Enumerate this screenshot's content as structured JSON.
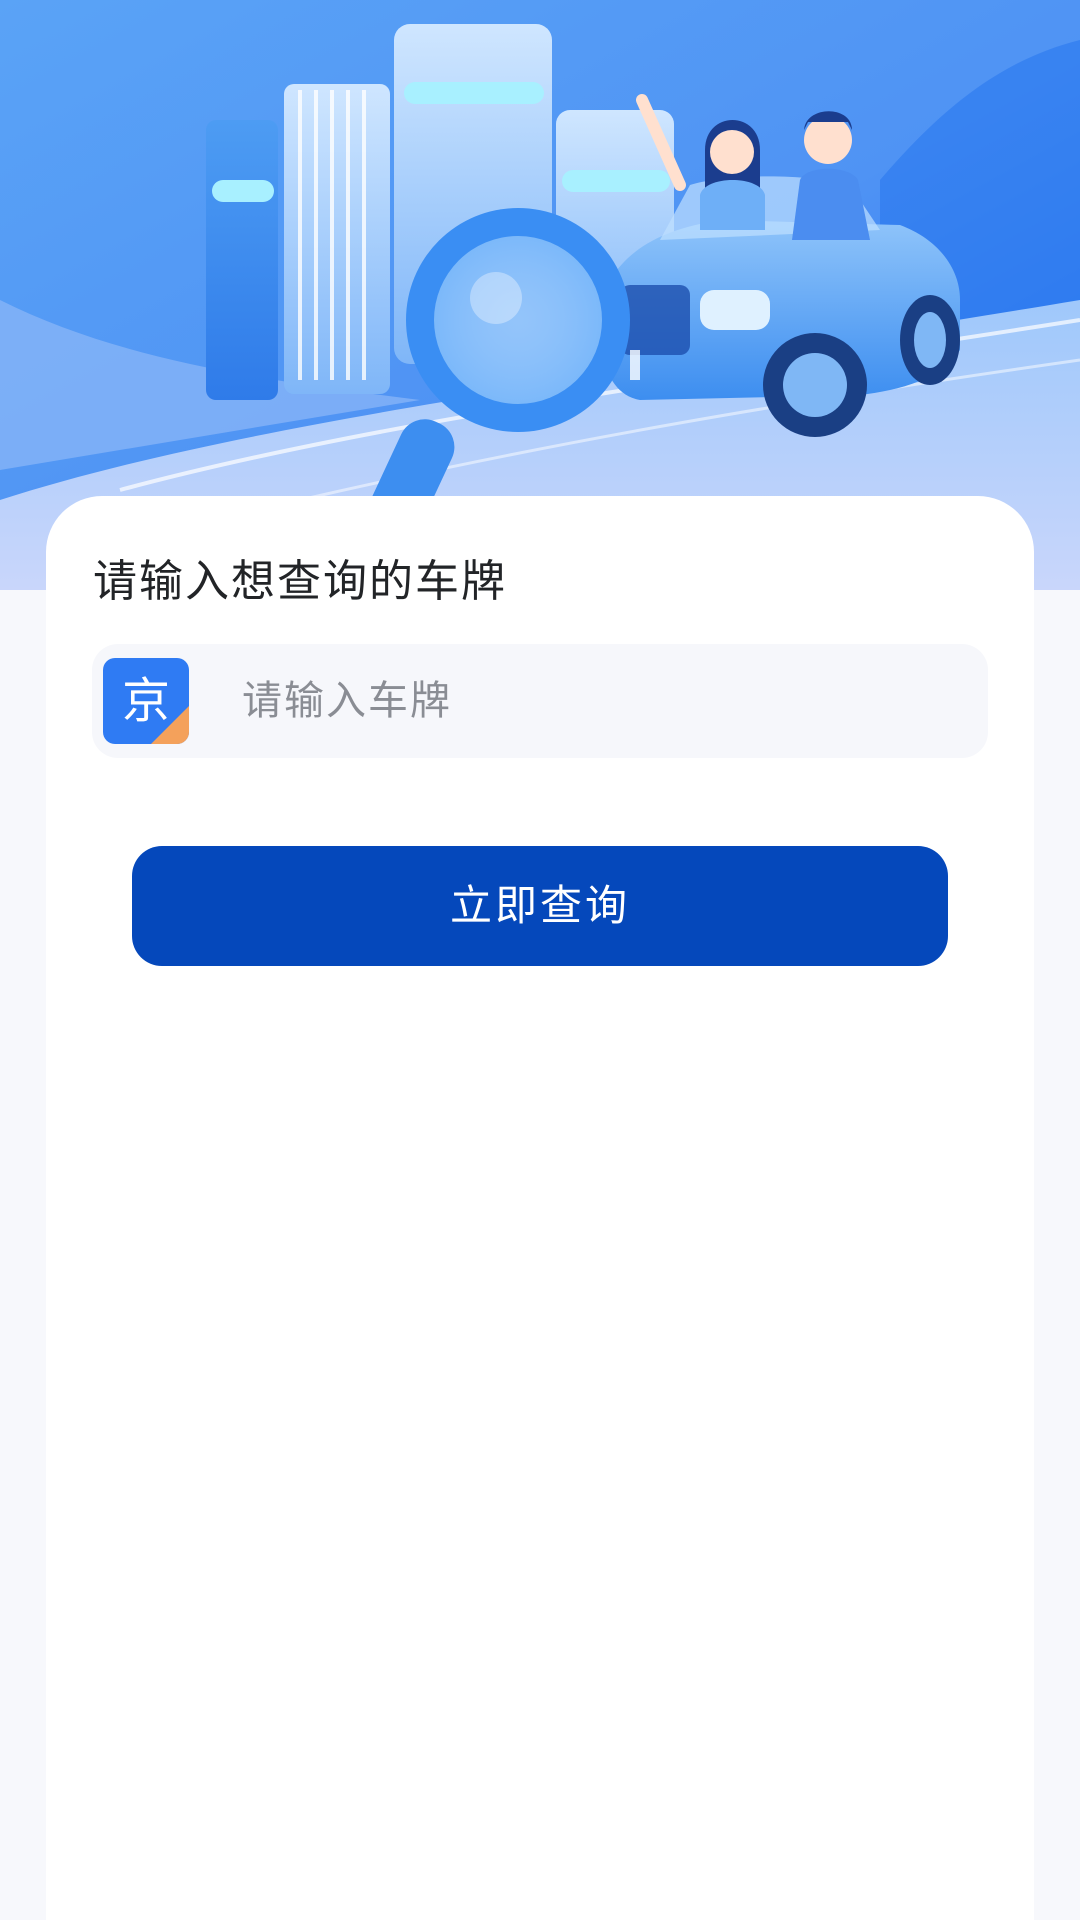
{
  "card": {
    "title": "请输入想查询的车牌"
  },
  "plate_input": {
    "province": "京",
    "placeholder": "请输入车牌",
    "value": ""
  },
  "actions": {
    "query_label": "立即查询"
  },
  "colors": {
    "primary_button": "#0548bb",
    "province_badge": "#2f7bf3",
    "province_badge_corner": "#f4a15b",
    "page_background": "#f7f8fc"
  },
  "icons": {
    "hero": "car-search-illustration"
  }
}
